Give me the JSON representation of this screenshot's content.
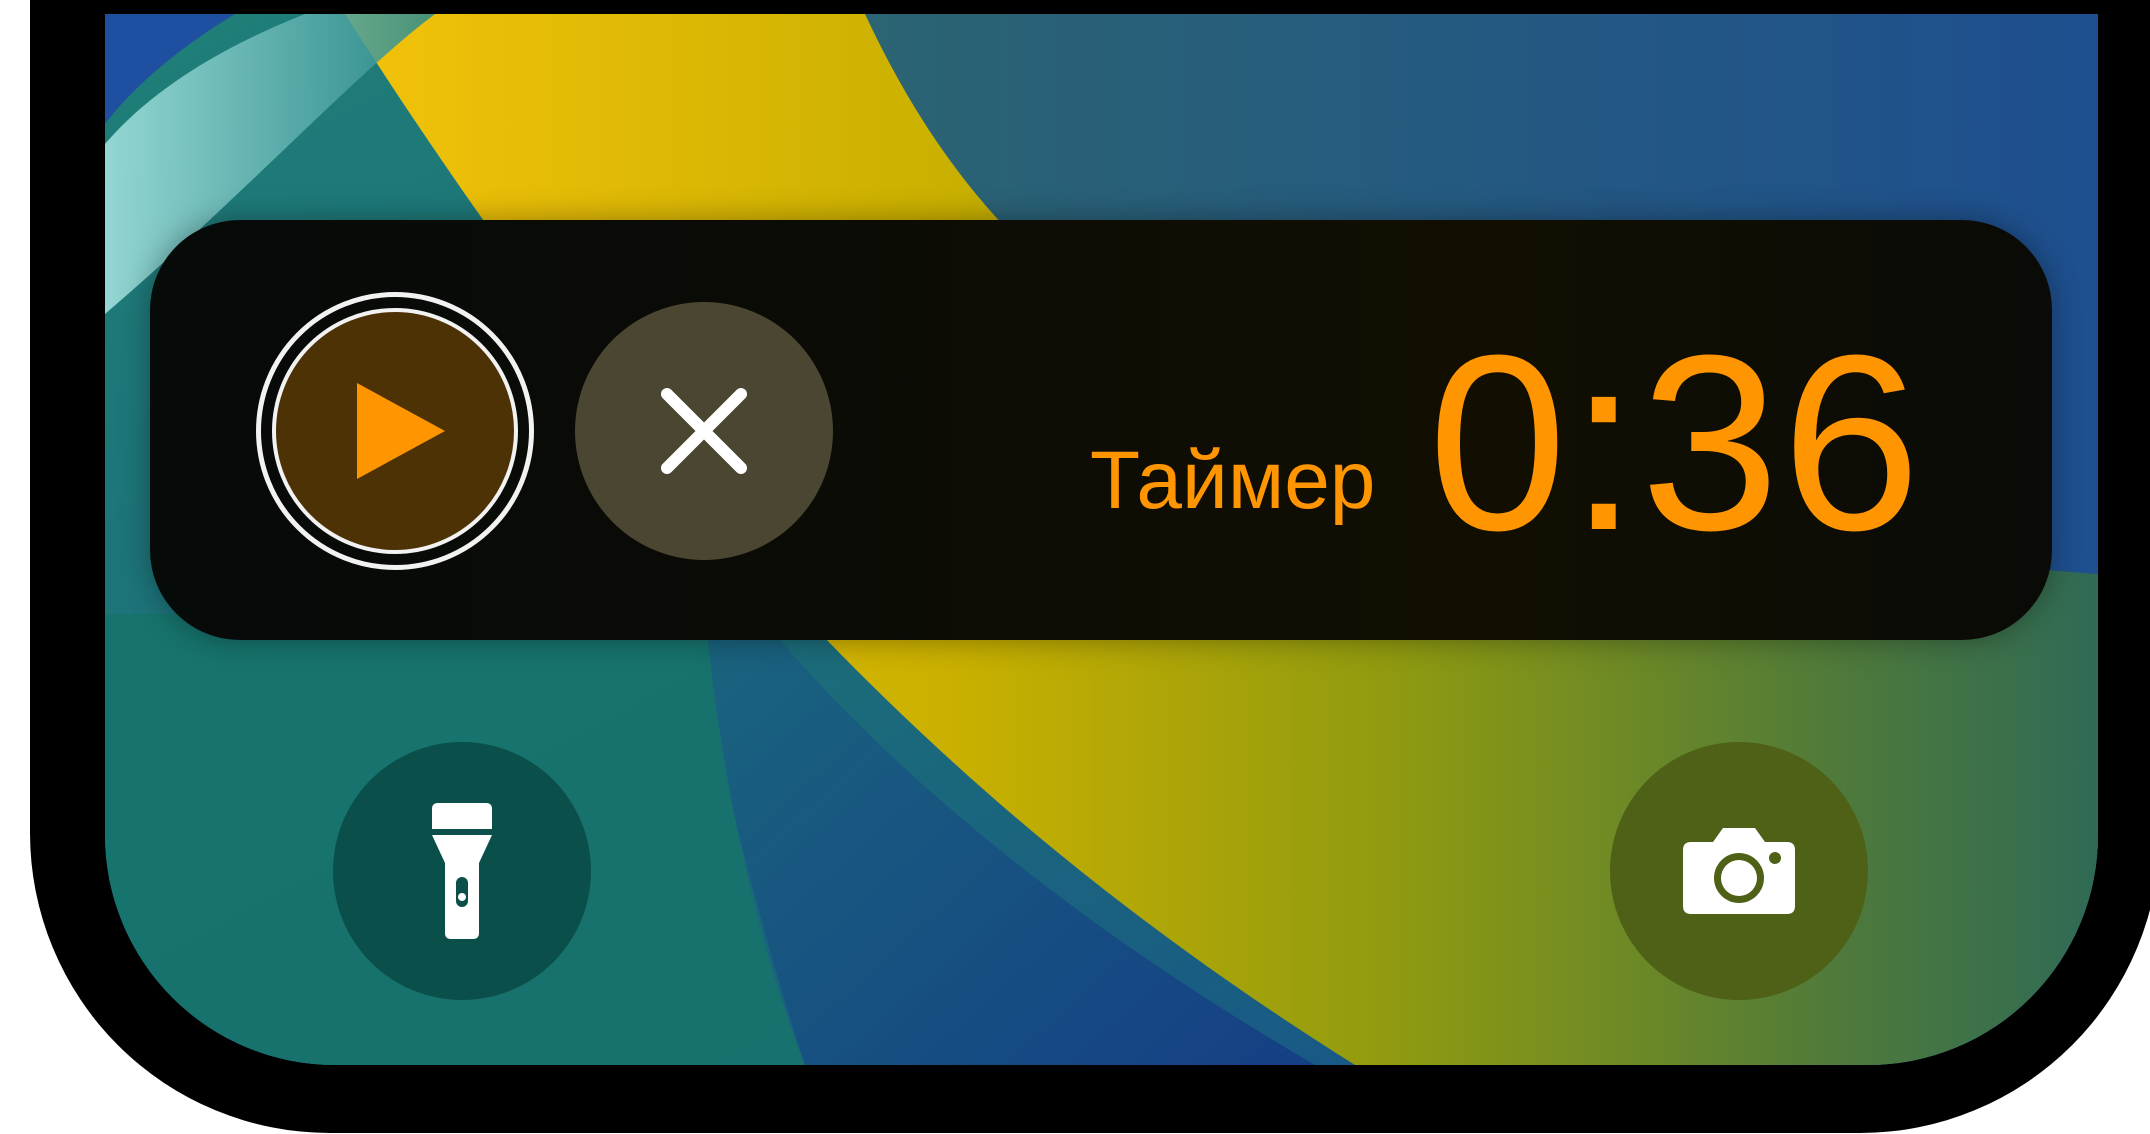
{
  "live_activity": {
    "label": "Таймер",
    "time": "0:36",
    "accent_color": "#ff9500",
    "play_button": {
      "icon": "play-icon"
    },
    "close_button": {
      "icon": "close-icon"
    }
  },
  "lock_screen": {
    "flashlight_button": {
      "icon": "flashlight-icon"
    },
    "camera_button": {
      "icon": "camera-icon"
    }
  },
  "colors": {
    "banner_background": "#0b0b06",
    "wallpaper_teal": "#1a7a70",
    "wallpaper_blue": "#1a4f85",
    "wallpaper_yellow": "#e8c400"
  }
}
